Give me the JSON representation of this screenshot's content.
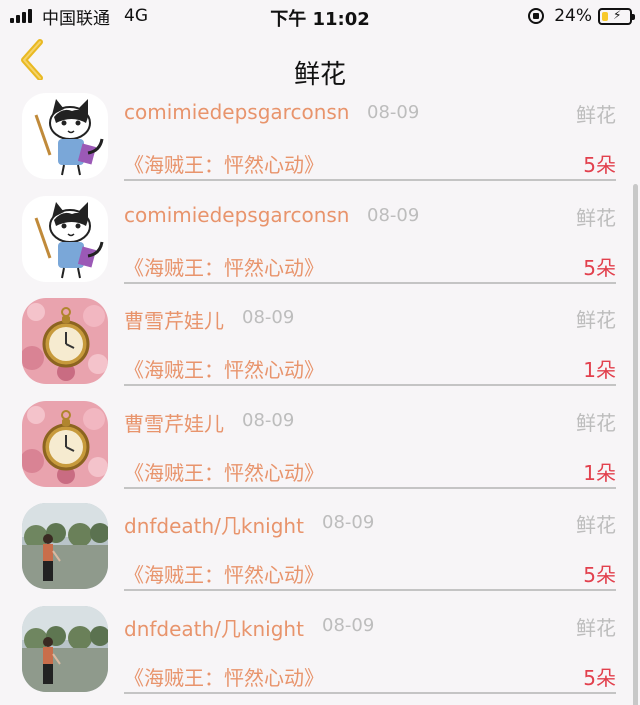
{
  "status_bar": {
    "carrier": "中国联通",
    "network": "4G",
    "time": "下午 11:02",
    "battery_percent": "24%",
    "battery_level": 0.24
  },
  "nav": {
    "title": "鲜花",
    "back_icon": "chevron-left-icon",
    "back_color": "#f2c230"
  },
  "records": [
    {
      "user": "comimiedepsgarconsn",
      "date": "08-09",
      "type": "鲜花",
      "book": "《海贼王：怦然心动》",
      "count": "5朵",
      "avatar": "cat-avatar"
    },
    {
      "user": "comimiedepsgarconsn",
      "date": "08-09",
      "type": "鲜花",
      "book": "《海贼王：怦然心动》",
      "count": "5朵",
      "avatar": "cat-avatar"
    },
    {
      "user": "曹雪芹娃儿",
      "date": "08-09",
      "type": "鲜花",
      "book": "《海贼王：怦然心动》",
      "count": "1朵",
      "avatar": "pocket-watch-avatar"
    },
    {
      "user": "曹雪芹娃儿",
      "date": "08-09",
      "type": "鲜花",
      "book": "《海贼王：怦然心动》",
      "count": "1朵",
      "avatar": "pocket-watch-avatar"
    },
    {
      "user": "dnfdeath/几knight",
      "date": "08-09",
      "type": "鲜花",
      "book": "《海贼王：怦然心动》",
      "count": "5朵",
      "avatar": "person-avatar"
    },
    {
      "user": "dnfdeath/几knight",
      "date": "08-09",
      "type": "鲜花",
      "book": "《海贼王：怦然心动》",
      "count": "5朵",
      "avatar": "person-avatar"
    }
  ],
  "colors": {
    "username": "#e8946c",
    "count": "#e2404d",
    "muted": "#bdbdbd",
    "background": "#f7f5f7"
  }
}
